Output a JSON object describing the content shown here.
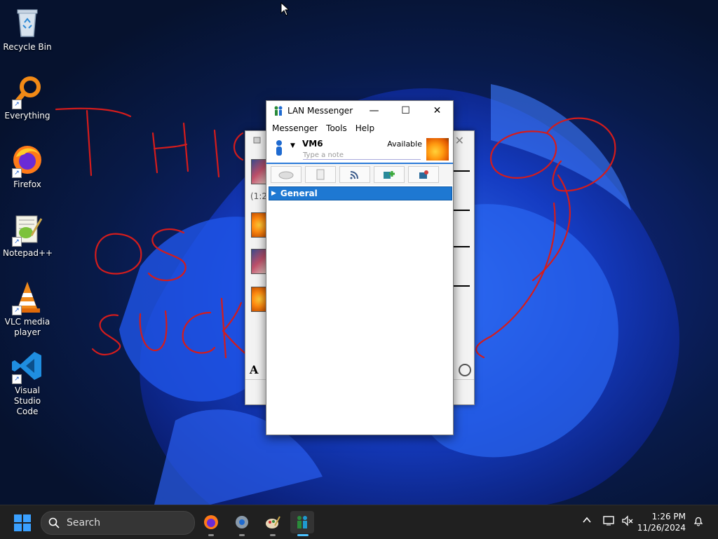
{
  "desktop": {
    "icons": [
      {
        "label": "Recycle Bin"
      },
      {
        "label": "Everything"
      },
      {
        "label": "Firefox"
      },
      {
        "label": "Notepad++"
      },
      {
        "label": "VLC media player"
      },
      {
        "label": "Visual Studio Code"
      }
    ],
    "annotations": [
      "THIS",
      "OS",
      "SUCK",
      "??"
    ]
  },
  "chat_window": {
    "timestamp": "(1:2",
    "font_button": "A"
  },
  "lan_window": {
    "title": "LAN Messenger",
    "menu": [
      "Messenger",
      "Tools",
      "Help"
    ],
    "user": {
      "name": "VM6",
      "status": "Available",
      "note_placeholder": "Type a note"
    },
    "toolbar_icons": [
      "broadcast-icon",
      "file-transfer-icon",
      "rss-icon",
      "add-contact-icon",
      "settings-icon"
    ],
    "groups": [
      {
        "label": "General"
      }
    ]
  },
  "taskbar": {
    "search_label": "Search",
    "time": "1:26 PM",
    "date": "11/26/2024"
  },
  "colors": {
    "accent": "#1e78d2",
    "taskbar": "#202020",
    "annotation": "#d41c1c"
  }
}
